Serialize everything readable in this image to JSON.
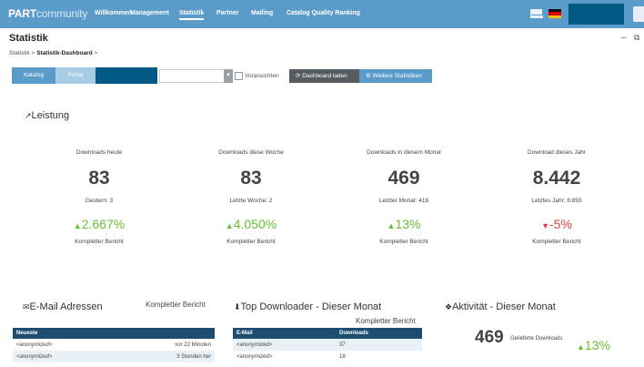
{
  "header": {
    "logo_bold": "PART",
    "logo_light": "community",
    "nav": [
      "Willkommen",
      "Management",
      "Statistik",
      "Partner",
      "Mailing",
      "Catalog Quality Ranking"
    ],
    "active_nav": "Statistik",
    "icons": [
      "mail-icon",
      "german-flag-icon"
    ]
  },
  "page": {
    "title": "Statistik",
    "breadcrumb_root": "Statistik",
    "breadcrumb_current": "Statistik-Dashboard",
    "sep": ">"
  },
  "toolbar": {
    "tab_katalog": "Katalog",
    "tab_portal": "Portal",
    "preview_label": "Voransichten",
    "load_button": "Dashboard laden",
    "more_button": "Weitere Statistiken"
  },
  "leistung": {
    "title": "Leistung",
    "stats": [
      {
        "label": "Downloads heute",
        "value": "83",
        "prev": "Gestern: 3",
        "pct": "2.667%",
        "dir": "up",
        "report": "Kompletter Bericht"
      },
      {
        "label": "Downloads diese Woche",
        "value": "83",
        "prev": "Letzte Woche: 2",
        "pct": "4.050%",
        "dir": "up",
        "report": "Kompletter Bericht"
      },
      {
        "label": "Downloads in diesem Monat",
        "value": "469",
        "prev": "Letzter Monat: 416",
        "pct": "13%",
        "dir": "up",
        "report": "Kompletter Bericht"
      },
      {
        "label": "Download dieses Jahr",
        "value": "8.442",
        "prev": "Letztes Jahr: 8.893",
        "pct": "-5%",
        "dir": "down",
        "report": "Kompletter Bericht"
      }
    ]
  },
  "email": {
    "title": "E-Mail Adressen",
    "report": "Kompletter Bericht",
    "col": "Neueste",
    "rows": [
      {
        "email": "<anonymized>",
        "time": "vor 22 Minuten"
      },
      {
        "email": "<anonymized>",
        "time": "3 Stunden her"
      }
    ]
  },
  "top": {
    "title": "Top Downloader - Dieser Monat",
    "report": "Kompletter Bericht",
    "col_email": "E-Mail",
    "col_downloads": "Downloads",
    "rows": [
      {
        "email": "<anonymized>",
        "downloads": "37"
      },
      {
        "email": "<anonymized>",
        "downloads": "18"
      }
    ]
  },
  "activity": {
    "title": "Aktivität - Dieser Monat",
    "value": "469",
    "label": "Gelieferte Downloads",
    "pct": "13%"
  },
  "colors": {
    "header": "#5b9bc9",
    "up": "#66c033",
    "down": "#e04040",
    "table_head": "#1e4d72"
  }
}
